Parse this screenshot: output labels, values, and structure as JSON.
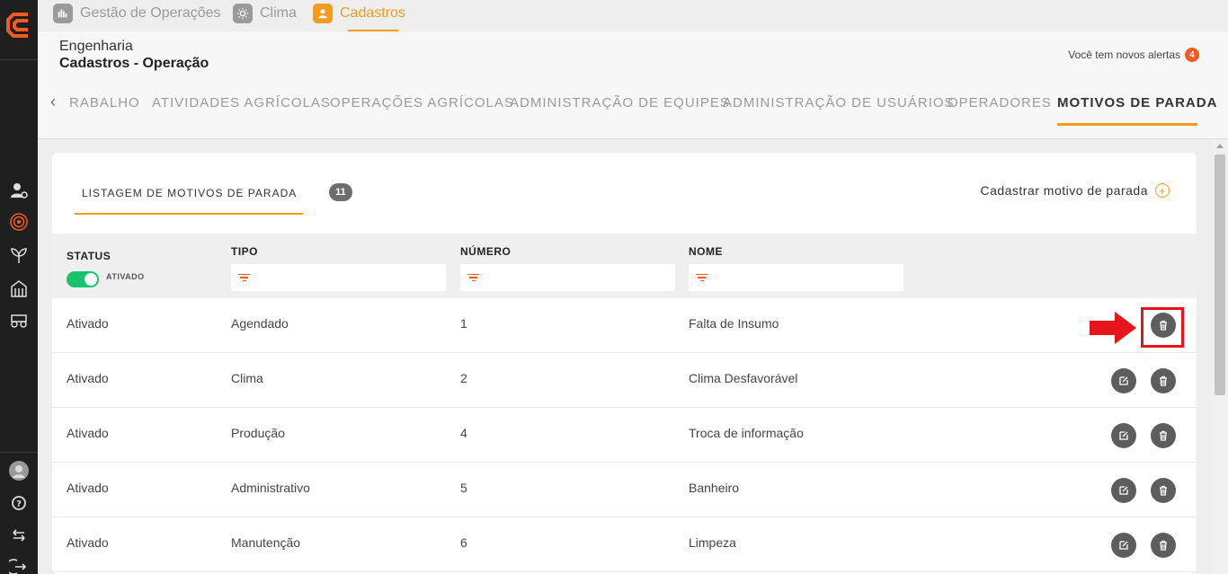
{
  "app_tabs": [
    {
      "label": "Gestão de Operações",
      "icon": "operations-icon",
      "active": false
    },
    {
      "label": "Clima",
      "icon": "sun-icon",
      "active": false
    },
    {
      "label": "Cadastros",
      "icon": "user-icon",
      "active": true
    }
  ],
  "header": {
    "breadcrumb_parent": "Engenharia",
    "breadcrumb_current": "Cadastros - Operação",
    "alerts_text": "Você tem novos alertas",
    "alerts_count": "4"
  },
  "subnav": {
    "items": [
      "RABALHO",
      "ATIVIDADES AGRÍCOLAS",
      "OPERAÇÕES AGRÍCOLAS",
      "ADMINISTRAÇÃO DE EQUIPES",
      "ADMINISTRAÇÃO DE USUÁRIOS",
      "OPERADORES",
      "MOTIVOS DE PARADA"
    ],
    "active_index": 6
  },
  "card": {
    "tab_label": "LISTAGEM DE MOTIVOS DE PARADA",
    "count": "11",
    "add_label": "Cadastrar motivo de parada"
  },
  "table": {
    "columns": [
      "STATUS",
      "TIPO",
      "NÚMERO",
      "NOME"
    ],
    "status_filter_label": "ATIVADO",
    "rows": [
      {
        "status": "Ativado",
        "tipo": "Agendado",
        "numero": "1",
        "nome": "Falta de Insumo"
      },
      {
        "status": "Ativado",
        "tipo": "Clima",
        "numero": "2",
        "nome": "Clima Desfavorável"
      },
      {
        "status": "Ativado",
        "tipo": "Produção",
        "numero": "4",
        "nome": "Troca de informação"
      },
      {
        "status": "Ativado",
        "tipo": "Administrativo",
        "numero": "5",
        "nome": "Banheiro"
      },
      {
        "status": "Ativado",
        "tipo": "Manutenção",
        "numero": "6",
        "nome": "Limpeza"
      }
    ]
  },
  "colors": {
    "accent": "#f29b1d",
    "alert": "#f25c22",
    "toggle_on": "#17c46b",
    "sidebar": "#1f1f1f",
    "highlight": "#e8141b"
  }
}
